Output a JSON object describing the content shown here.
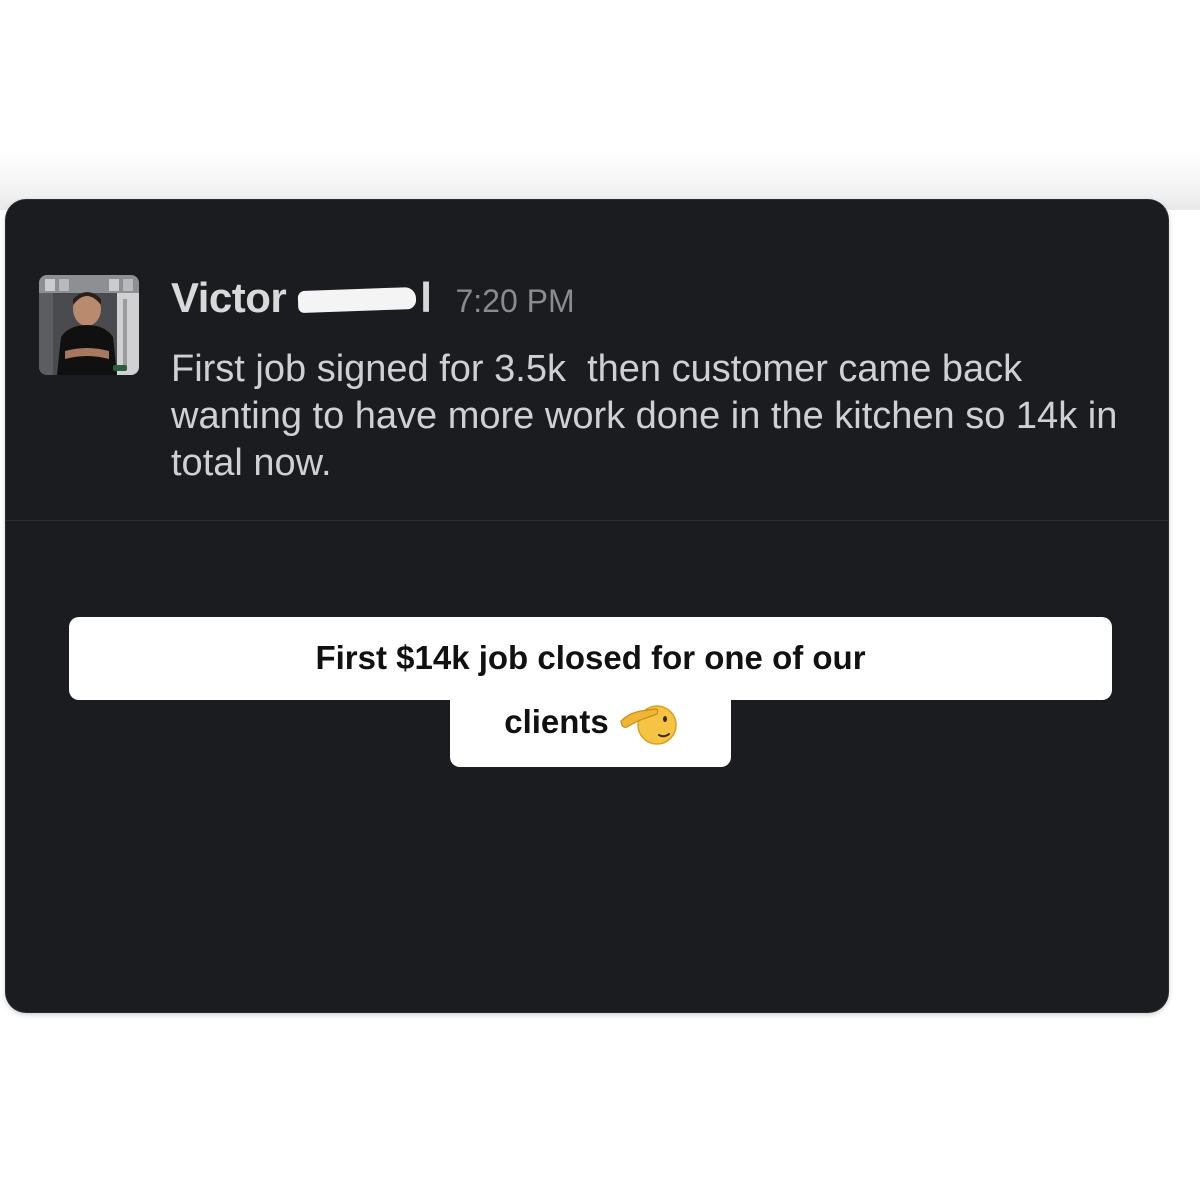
{
  "message": {
    "author_first_name": "Victor",
    "author_last_name_redacted": "l",
    "timestamp": "7:20 PM",
    "text": "First job signed for 3.5k  then customer came back wanting to have more work done in the kitchen so 14k in total now."
  },
  "caption": {
    "line1": "First $14k job closed for one of our",
    "line2": "clients",
    "emoji": "saluting-face-icon"
  },
  "colors": {
    "card_background": "#1b1c1f",
    "name_text": "#d9d9d9",
    "timestamp_text": "#8a8b8d",
    "message_text": "#cfd0d2",
    "caption_background": "#ffffff",
    "caption_text": "#111111"
  }
}
